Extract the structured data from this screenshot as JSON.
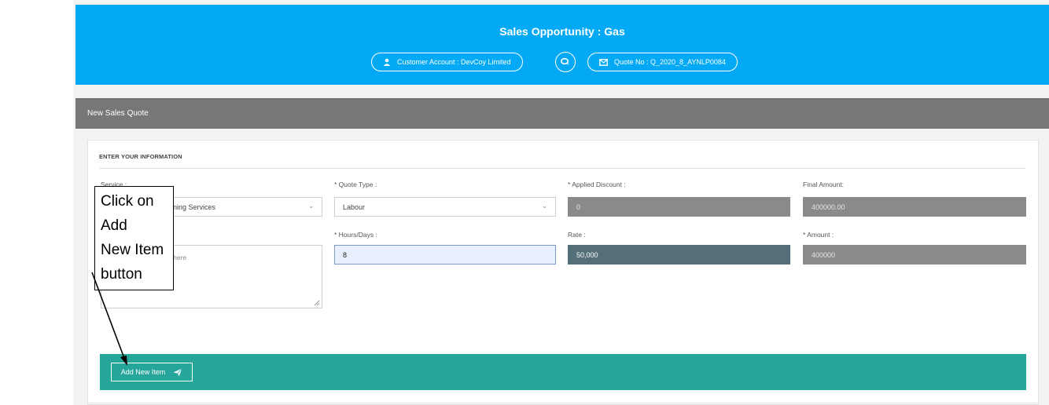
{
  "header": {
    "title": "Sales Opportunity : Gas",
    "customer_account": "Customer Account : DevCoy Limited",
    "quote_no": "Quote No : Q_2020_8_AYNLP0084"
  },
  "section_bar": {
    "title": "New Sales Quote"
  },
  "form": {
    "section_title": "ENTER YOUR INFORMATION",
    "service": {
      "label": "Service :",
      "value": "aning Services"
    },
    "quote_type": {
      "label": "* Quote Type :",
      "value": "Labour"
    },
    "applied_discount": {
      "label": "* Applied Discount :",
      "value": "0"
    },
    "final_amount": {
      "label": "Final Amount:",
      "value": "400000.00"
    },
    "description": {
      "placeholder": "n here"
    },
    "hours_days": {
      "label": "* Hours/Days :",
      "value": "8"
    },
    "rate": {
      "label": "Rate :",
      "value": "50,000"
    },
    "amount": {
      "label": "* Amount :",
      "value": "400000"
    }
  },
  "actions": {
    "add_new_item_label": "Add New Item"
  },
  "callout": {
    "lines": [
      "Click on Add",
      "New Item",
      "button"
    ]
  },
  "colors": {
    "header": "#03a9f4",
    "section_bar": "#777777",
    "action_bar": "#26a69a",
    "rate_field": "#546e7a",
    "readonly_field": "#8a8a8a"
  }
}
